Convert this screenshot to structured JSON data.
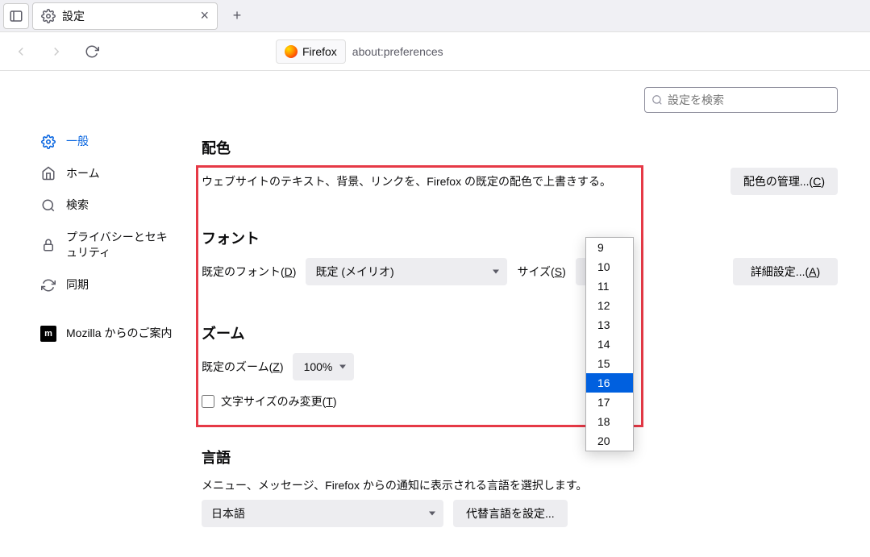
{
  "tab": {
    "title": "設定"
  },
  "toolbar": {
    "brand": "Firefox",
    "url": "about:preferences"
  },
  "search": {
    "placeholder": "設定を検索"
  },
  "sidebar": {
    "items": [
      {
        "label": "一般"
      },
      {
        "label": "ホーム"
      },
      {
        "label": "検索"
      },
      {
        "label": "プライバシーとセキュリティ"
      },
      {
        "label": "同期"
      },
      {
        "label": "Mozilla からのご案内"
      }
    ]
  },
  "sections": {
    "colors": {
      "title": "配色",
      "desc": "ウェブサイトのテキスト、背景、リンクを、Firefox の既定の配色で上書きする。",
      "manage_btn": "配色の管理...(",
      "manage_btn_key": "C",
      "manage_btn_suffix": ")"
    },
    "fonts": {
      "title": "フォント",
      "default_font_label_pre": "既定のフォント(",
      "default_font_label_key": "D",
      "default_font_label_suf": ")",
      "default_font_value": "既定 (メイリオ)",
      "size_label_pre": "サイズ(",
      "size_label_key": "S",
      "size_label_suf": ")",
      "size_value": "16",
      "advanced_btn_pre": "詳細設定...(",
      "advanced_btn_key": "A",
      "advanced_btn_suf": ")"
    },
    "zoom": {
      "title": "ズーム",
      "default_zoom_label_pre": "既定のズーム(",
      "default_zoom_label_key": "Z",
      "default_zoom_label_suf": ")",
      "default_zoom_value": "100%",
      "text_only_label_pre": "文字サイズのみ変更(",
      "text_only_label_key": "T",
      "text_only_label_suf": ")"
    },
    "language": {
      "title": "言語",
      "desc": "メニュー、メッセージ、Firefox からの通知に表示される言語を選択します。",
      "value": "日本語",
      "alt_btn": "代替言語を設定..."
    }
  },
  "size_dropdown": {
    "options": [
      "9",
      "10",
      "11",
      "12",
      "13",
      "14",
      "15",
      "16",
      "17",
      "18",
      "20"
    ],
    "selected": "16"
  },
  "icons": {
    "gear": "gear-icon",
    "home": "home-icon",
    "search": "search-icon",
    "lock": "lock-icon",
    "sync": "sync-icon",
    "mozilla": "mozilla-icon",
    "back": "back-icon",
    "forward": "forward-icon",
    "reload": "reload-icon",
    "sidebar": "sidebar-icon",
    "close": "close-icon",
    "plus": "plus-icon",
    "chevron": "chevron-down-icon",
    "magnify": "magnify-icon"
  }
}
